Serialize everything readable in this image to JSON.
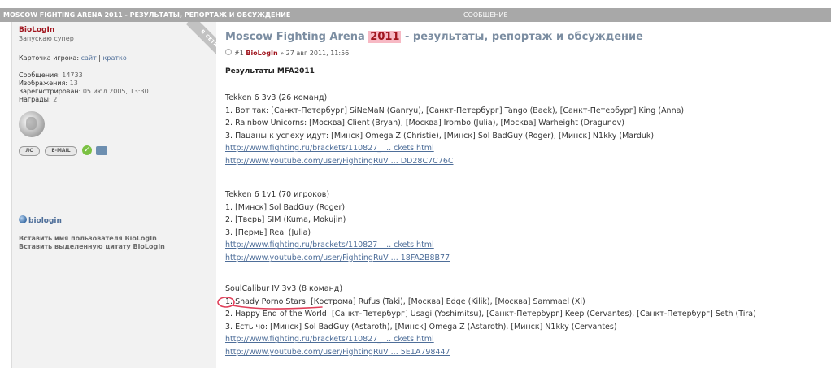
{
  "header": {
    "title": "MOSCOW FIGHTING ARENA 2011 - РЕЗУЛЬТАТЫ, РЕПОРТАЖ И ОБСУЖДЕНИЕ",
    "message_label": "СООБЩЕНИЕ"
  },
  "user": {
    "name": "BioLogIn",
    "rank": "Запускаю супер",
    "online_ribbon": "В СЕТИ",
    "card_label": "Карточка игрока:",
    "card_site": "сайт",
    "card_sep": "|",
    "card_brief": "кратко",
    "stats": [
      {
        "label": "Сообщения:",
        "value": "14733"
      },
      {
        "label": "Изображения:",
        "value": "13"
      },
      {
        "label": "Зарегистрирован:",
        "value": "05 июл 2005, 13:30"
      },
      {
        "label": "Награды:",
        "value": "2"
      }
    ],
    "buttons": {
      "pm": "ЛС",
      "email": "E-MAIL"
    },
    "site_link": "biologin",
    "insert_name": "Вставить имя пользователя BioLogIn",
    "insert_quote": "Вставить выделенную цитату BioLogIn"
  },
  "post": {
    "title_before": "Moscow Fighting Arena ",
    "title_year": "2011",
    "title_after": " - результаты, репортаж и обсуждение",
    "number": "#1",
    "author": "BioLogIn",
    "date_sep": "»",
    "date": "27 авг 2011, 11:56",
    "results_heading": "Результаты MFA2011",
    "sections": [
      {
        "title": "Tekken 6 3v3 (26 команд)",
        "lines": [
          "1. Вот так: [Санкт-Петербург] SiNeMaN (Ganryu), [Санкт-Петербург] Tango (Baek), [Санкт-Петербург] King (Anna)",
          "2. Rainbow Unicorns: [Москва] Client (Bryan), [Москва] Irombo (Julia), [Москва] Warheight (Dragunov)",
          "3. Пацаны к успеху идут: [Минск] Omega Z (Christie), [Минск] Sol BadGuy (Roger), [Минск] N1kky (Marduk)"
        ],
        "links": [
          "http://www.fighting.ru/brackets/110827_ ... ckets.html",
          "http://www.youtube.com/user/FightingRuV ... DD28C7C76C"
        ]
      },
      {
        "title": "Tekken 6 1v1 (70 игроков)",
        "lines": [
          "1. [Минск] Sol BadGuy (Roger)",
          "2. [Тверь] SIM (Kuma, Mokujin)",
          "3. [Пермь] Real (Julia)"
        ],
        "links": [
          "http://www.fighting.ru/brackets/110827_ ... ckets.html",
          "http://www.youtube.com/user/FightingRuV ... 18FA2B8B77"
        ]
      },
      {
        "title": "SoulCalibur IV 3v3 (8 команд)",
        "lines": [
          "1. Shady Porno Stars: [Кострома] Rufus (Taki), [Москва] Edge (Kilik), [Москва] Sammael (Xi)",
          "2. Happy End of the World: [Санкт-Петербург] Usagi (Yoshimitsu), [Санкт-Петербург] Keep (Cervantes), [Санкт-Петербург] Seth (Tira)",
          "3. Есть чо: [Минск] Sol BadGuy (Astaroth), [Минск] Omega Z (Astaroth), [Минск] N1kky (Cervantes)"
        ],
        "links": [
          "http://www.fighting.ru/brackets/110827_ ... ckets.html",
          "http://www.youtube.com/user/FightingRuV ... 5E1A798447"
        ]
      }
    ]
  },
  "colors": {
    "header_bg": "#a8a8a8",
    "username": "#a0151e",
    "link": "#4e6e99",
    "title": "#7c8ea2",
    "highlight": "#f7b9c4",
    "annotation": "#e0405a"
  }
}
